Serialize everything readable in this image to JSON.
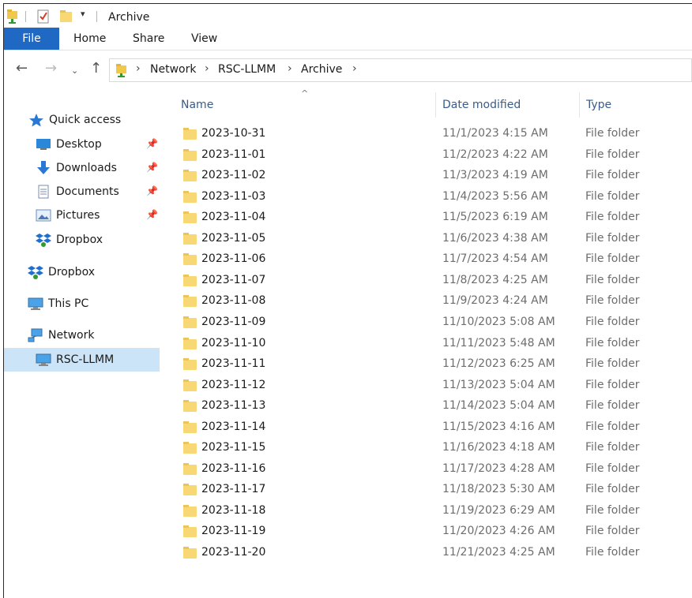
{
  "window": {
    "title": "Archive"
  },
  "ribbon": {
    "tabs": [
      "File",
      "Home",
      "Share",
      "View"
    ]
  },
  "address": {
    "crumbs": [
      "Network",
      "RSC-LLMM",
      "Archive"
    ]
  },
  "sidebar": {
    "quick_access": "Quick access",
    "pinned": [
      "Desktop",
      "Downloads",
      "Documents",
      "Pictures"
    ],
    "dropbox_sub": "Dropbox",
    "dropbox": "Dropbox",
    "this_pc": "This PC",
    "network": "Network",
    "network_child": "RSC-LLMM"
  },
  "columns": {
    "name": "Name",
    "date": "Date modified",
    "type": "Type"
  },
  "files": [
    {
      "name": "2023-10-31",
      "date": "11/1/2023 4:15 AM",
      "type": "File folder"
    },
    {
      "name": "2023-11-01",
      "date": "11/2/2023 4:22 AM",
      "type": "File folder"
    },
    {
      "name": "2023-11-02",
      "date": "11/3/2023 4:19 AM",
      "type": "File folder"
    },
    {
      "name": "2023-11-03",
      "date": "11/4/2023 5:56 AM",
      "type": "File folder"
    },
    {
      "name": "2023-11-04",
      "date": "11/5/2023 6:19 AM",
      "type": "File folder"
    },
    {
      "name": "2023-11-05",
      "date": "11/6/2023 4:38 AM",
      "type": "File folder"
    },
    {
      "name": "2023-11-06",
      "date": "11/7/2023 4:54 AM",
      "type": "File folder"
    },
    {
      "name": "2023-11-07",
      "date": "11/8/2023 4:25 AM",
      "type": "File folder"
    },
    {
      "name": "2023-11-08",
      "date": "11/9/2023 4:24 AM",
      "type": "File folder"
    },
    {
      "name": "2023-11-09",
      "date": "11/10/2023 5:08 AM",
      "type": "File folder"
    },
    {
      "name": "2023-11-10",
      "date": "11/11/2023 5:48 AM",
      "type": "File folder"
    },
    {
      "name": "2023-11-11",
      "date": "11/12/2023 6:25 AM",
      "type": "File folder"
    },
    {
      "name": "2023-11-12",
      "date": "11/13/2023 5:04 AM",
      "type": "File folder"
    },
    {
      "name": "2023-11-13",
      "date": "11/14/2023 5:04 AM",
      "type": "File folder"
    },
    {
      "name": "2023-11-14",
      "date": "11/15/2023 4:16 AM",
      "type": "File folder"
    },
    {
      "name": "2023-11-15",
      "date": "11/16/2023 4:18 AM",
      "type": "File folder"
    },
    {
      "name": "2023-11-16",
      "date": "11/17/2023 4:28 AM",
      "type": "File folder"
    },
    {
      "name": "2023-11-17",
      "date": "11/18/2023 5:30 AM",
      "type": "File folder"
    },
    {
      "name": "2023-11-18",
      "date": "11/19/2023 6:29 AM",
      "type": "File folder"
    },
    {
      "name": "2023-11-19",
      "date": "11/20/2023 4:26 AM",
      "type": "File folder"
    },
    {
      "name": "2023-11-20",
      "date": "11/21/2023 4:25 AM",
      "type": "File folder"
    }
  ],
  "colors": {
    "accent": "#1f69c4",
    "folder": "#f8d775",
    "selection": "#cce4f7",
    "header_text": "#3b5b89"
  }
}
